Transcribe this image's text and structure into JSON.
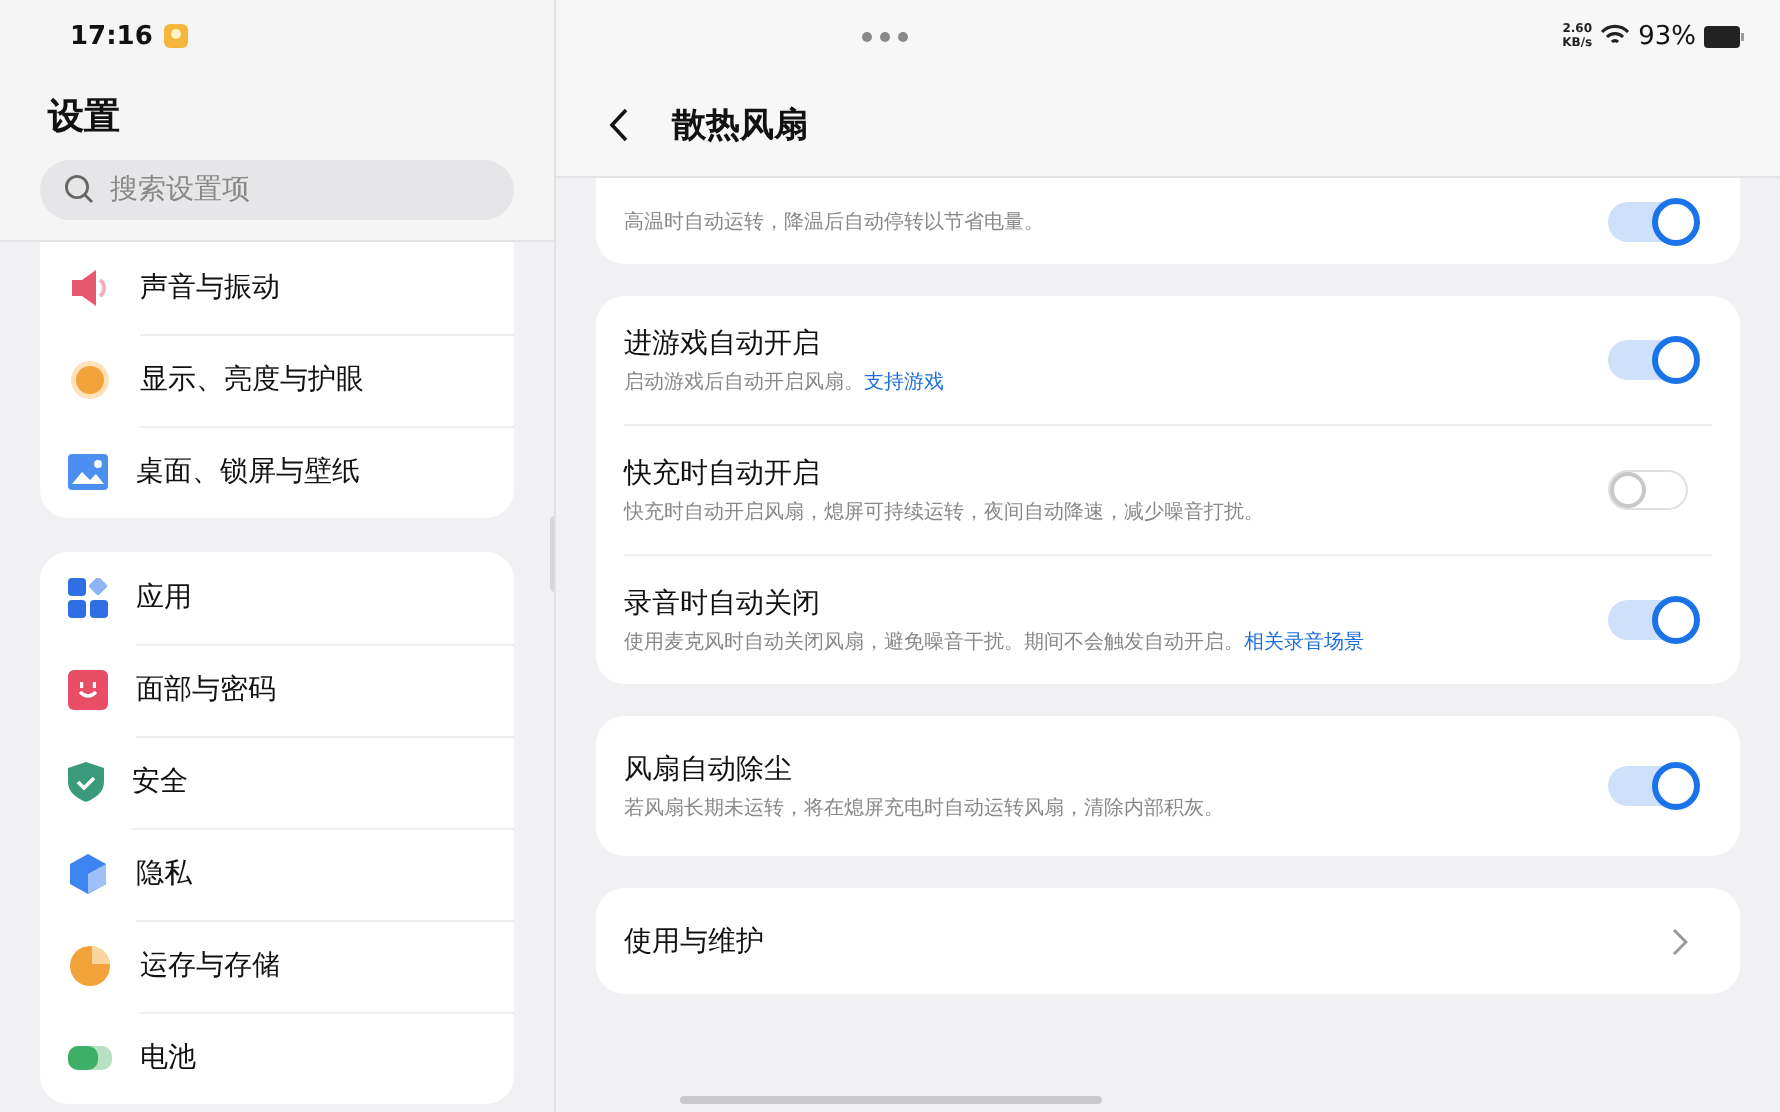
{
  "status_bar": {
    "time": "17:16",
    "net_speed": "2.60",
    "net_unit": "KB/s",
    "battery": "93%"
  },
  "sidebar": {
    "title": "设置",
    "search": {
      "placeholder": "搜索设置项"
    },
    "groups": [
      {
        "items": [
          {
            "label": "声音与振动"
          },
          {
            "label": "显示、亮度与护眼"
          },
          {
            "label": "桌面、锁屏与壁纸"
          }
        ]
      },
      {
        "items": [
          {
            "label": "应用"
          },
          {
            "label": "面部与密码"
          },
          {
            "label": "安全"
          },
          {
            "label": "隐私"
          },
          {
            "label": "运存与存储"
          },
          {
            "label": "电池"
          }
        ]
      }
    ]
  },
  "detail": {
    "title": "散热风扇",
    "groups": [
      {
        "rows": [
          {
            "kind": "toggle",
            "description": "高温时自动运转，降温后自动停转以节省电量。",
            "on": true
          }
        ]
      },
      {
        "rows": [
          {
            "kind": "toggle",
            "title": "进游戏自动开启",
            "description": "启动游戏后自动开启风扇。",
            "link": "支持游戏",
            "on": true
          },
          {
            "kind": "toggle",
            "title": "快充时自动开启",
            "description": "快充时自动开启风扇，熄屏可持续运转，夜间自动降速，减少噪音打扰。",
            "on": false
          },
          {
            "kind": "toggle",
            "title": "录音时自动关闭",
            "description": "使用麦克风时自动关闭风扇，避免噪音干扰。期间不会触发自动开启。",
            "link": "相关录音场景",
            "on": true
          }
        ]
      },
      {
        "rows": [
          {
            "kind": "toggle",
            "title": "风扇自动除尘",
            "description": "若风扇长期未运转，将在熄屏充电时自动运转风扇，清除内部积灰。",
            "on": true
          }
        ]
      },
      {
        "rows": [
          {
            "kind": "nav",
            "title": "使用与维护"
          }
        ]
      }
    ]
  }
}
